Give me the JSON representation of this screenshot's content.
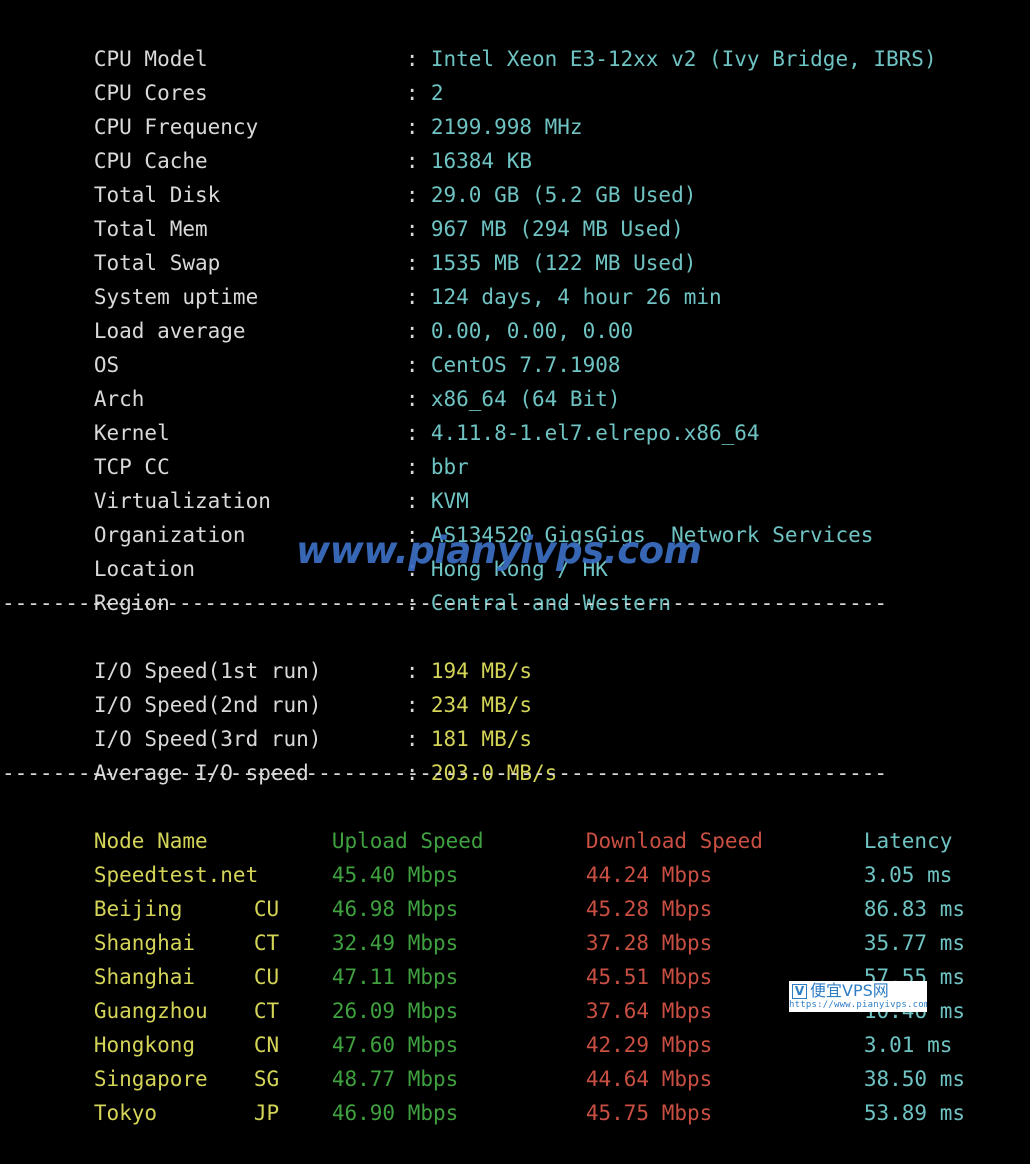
{
  "terminal": {
    "background_color": "#000000",
    "label_color": "#d9d9d9",
    "value_color": "#6fc3c3",
    "io_value_color": "#d4d458",
    "upload_color": "#3fa13f",
    "download_color": "#c94f43",
    "latency_color": "#6fc3c3",
    "colon": ":",
    "separator": "----------------------------------------------------------------------"
  },
  "system_info": {
    "rows": [
      {
        "label": "CPU Model",
        "value": "Intel Xeon E3-12xx v2 (Ivy Bridge, IBRS)"
      },
      {
        "label": "CPU Cores",
        "value": "2"
      },
      {
        "label": "CPU Frequency",
        "value": "2199.998 MHz"
      },
      {
        "label": "CPU Cache",
        "value": "16384 KB"
      },
      {
        "label": "Total Disk",
        "value": "29.0 GB (5.2 GB Used)"
      },
      {
        "label": "Total Mem",
        "value": "967 MB (294 MB Used)"
      },
      {
        "label": "Total Swap",
        "value": "1535 MB (122 MB Used)"
      },
      {
        "label": "System uptime",
        "value": "124 days, 4 hour 26 min"
      },
      {
        "label": "Load average",
        "value": "0.00, 0.00, 0.00"
      },
      {
        "label": "OS",
        "value": "CentOS 7.7.1908"
      },
      {
        "label": "Arch",
        "value": "x86_64 (64 Bit)"
      },
      {
        "label": "Kernel",
        "value": "4.11.8-1.el7.elrepo.x86_64"
      },
      {
        "label": "TCP CC",
        "value": "bbr"
      },
      {
        "label": "Virtualization",
        "value": "KVM"
      },
      {
        "label": "Organization",
        "value": "AS134520 GigsGigs  Network Services"
      },
      {
        "label": "Location",
        "value": "Hong Kong / HK"
      },
      {
        "label": "Region",
        "value": "Central and Western"
      }
    ]
  },
  "io_speed": {
    "rows": [
      {
        "label": "I/O Speed(1st run)",
        "value": "194 MB/s"
      },
      {
        "label": "I/O Speed(2nd run)",
        "value": "234 MB/s"
      },
      {
        "label": "I/O Speed(3rd run)",
        "value": "181 MB/s"
      },
      {
        "label": "Average I/O speed",
        "value": "203.0 MB/s"
      }
    ]
  },
  "speedtest": {
    "headers": {
      "node": "Node Name",
      "isp": "",
      "upload": "Upload Speed",
      "download": "Download Speed",
      "latency": "Latency"
    },
    "rows": [
      {
        "node": "Speedtest.net",
        "isp": "",
        "upload": "45.40 Mbps",
        "download": "44.24 Mbps",
        "latency": "3.05 ms"
      },
      {
        "node": "Beijing",
        "isp": "CU",
        "upload": "46.98 Mbps",
        "download": "45.28 Mbps",
        "latency": "86.83 ms"
      },
      {
        "node": "Shanghai",
        "isp": "CT",
        "upload": "32.49 Mbps",
        "download": "37.28 Mbps",
        "latency": "35.77 ms"
      },
      {
        "node": "Shanghai",
        "isp": "CU",
        "upload": "47.11 Mbps",
        "download": "45.51 Mbps",
        "latency": "57.55 ms"
      },
      {
        "node": "Guangzhou",
        "isp": "CT",
        "upload": "26.09 Mbps",
        "download": "37.64 Mbps",
        "latency": "10.46 ms"
      },
      {
        "node": "Hongkong",
        "isp": "CN",
        "upload": "47.60 Mbps",
        "download": "42.29 Mbps",
        "latency": "3.01 ms"
      },
      {
        "node": "Singapore",
        "isp": "SG",
        "upload": "48.77 Mbps",
        "download": "44.64 Mbps",
        "latency": "38.50 ms"
      },
      {
        "node": "Tokyo",
        "isp": "JP",
        "upload": "46.90 Mbps",
        "download": "45.75 Mbps",
        "latency": "53.89 ms"
      }
    ]
  },
  "watermarks": {
    "text_overlay": "www.pianyivps.com",
    "text_color": "#3b6fc4",
    "badge": {
      "mark": "V",
      "name": "便宜VPS网",
      "url": "https://www.pianyivps.com",
      "color": "#2f7ec4",
      "background": "#ffffff"
    }
  }
}
